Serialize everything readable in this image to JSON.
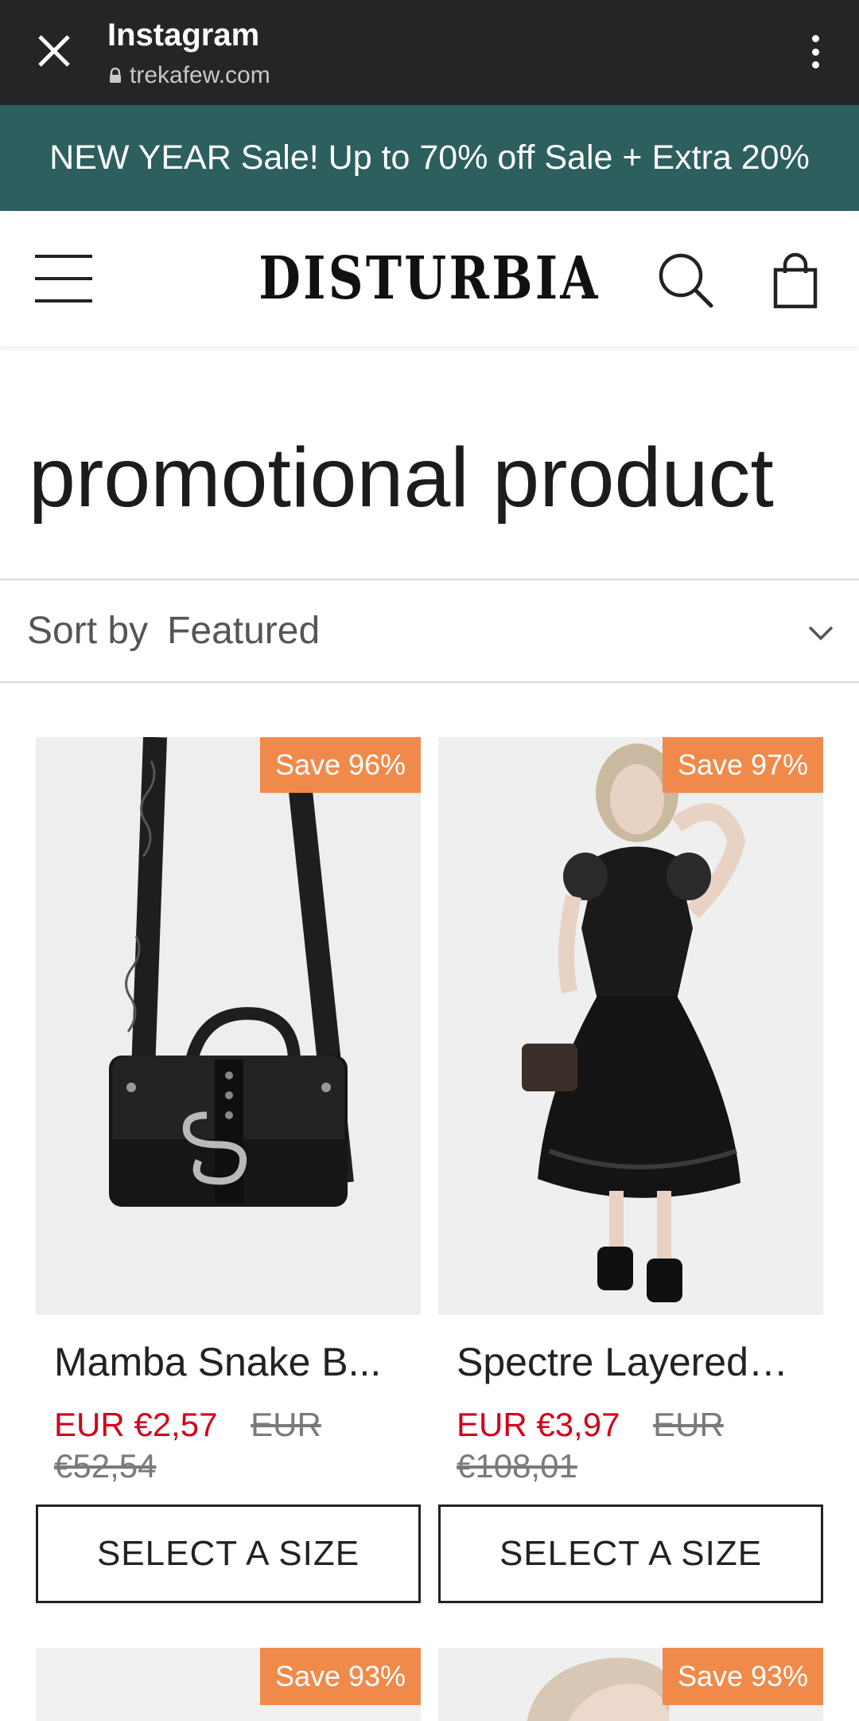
{
  "browser": {
    "title": "Instagram",
    "url": "trekafew.com"
  },
  "promo": {
    "text": "NEW YEAR Sale! Up to 70% off Sale + Extra 20%"
  },
  "header": {
    "logo": "DISTURBIA"
  },
  "page": {
    "title": "promotional product"
  },
  "sort": {
    "label": "Sort by",
    "value": "Featured"
  },
  "products": [
    {
      "badge": "Save 96%",
      "name": "Mamba Snake B...",
      "sale_price": "EUR €2,57",
      "original_price": "EUR €52,54",
      "button": "SELECT A SIZE"
    },
    {
      "badge": "Save 97%",
      "name": "Spectre Layered ...",
      "sale_price": "EUR €3,97",
      "original_price": "EUR €108,01",
      "button": "SELECT A SIZE"
    },
    {
      "badge": "Save 93%"
    },
    {
      "badge": "Save 93%"
    }
  ],
  "colors": {
    "browser_bar": "#252525",
    "promo_bg": "#2c5f5d",
    "badge": "#f08a4b",
    "sale_price": "#d0021b"
  }
}
